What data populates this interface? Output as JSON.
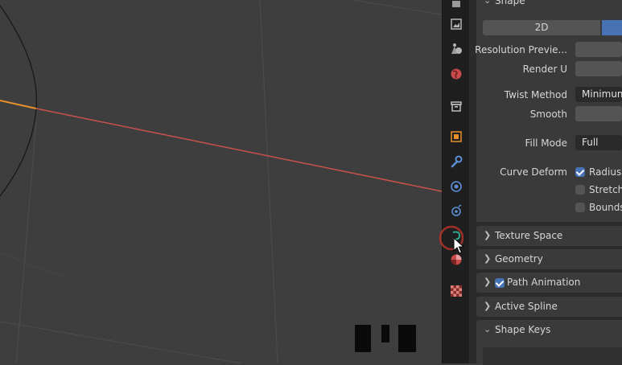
{
  "shape_panel": {
    "title": "Shape",
    "mode_2d": "2D",
    "resolution_preview_label": "Resolution Previe...",
    "render_u_label": "Render U",
    "twist_method_label": "Twist Method",
    "twist_method_value": "Minimum",
    "smooth_label": "Smooth",
    "fill_mode_label": "Fill Mode",
    "fill_mode_value": "Full",
    "curve_deform_label": "Curve Deform",
    "radius_label": "Radius",
    "stretch_label": "Stretch",
    "bounds_label": "Bounds",
    "radius_checked": true,
    "stretch_checked": false,
    "bounds_checked": false
  },
  "sections": {
    "texture_space": "Texture Space",
    "geometry": "Geometry",
    "path_animation": "Path Animation",
    "active_spline": "Active Spline",
    "shape_keys": "Shape Keys"
  },
  "colors": {
    "accent": "#4772b3",
    "curve_line": "#c9524a",
    "selected_origin": "#e8902a",
    "cursor_circle": "#c0392b",
    "curve_tab_icon": "#2fb99a"
  },
  "tab_icons": [
    "tool-icon",
    "render-icon",
    "output-icon",
    "view-layer-icon",
    "scene-icon",
    "world-icon",
    "collection-icon",
    "object-icon",
    "modifier-icon",
    "particles-icon",
    "physics-icon",
    "curve-data-icon",
    "material-icon",
    "texture-icon"
  ]
}
